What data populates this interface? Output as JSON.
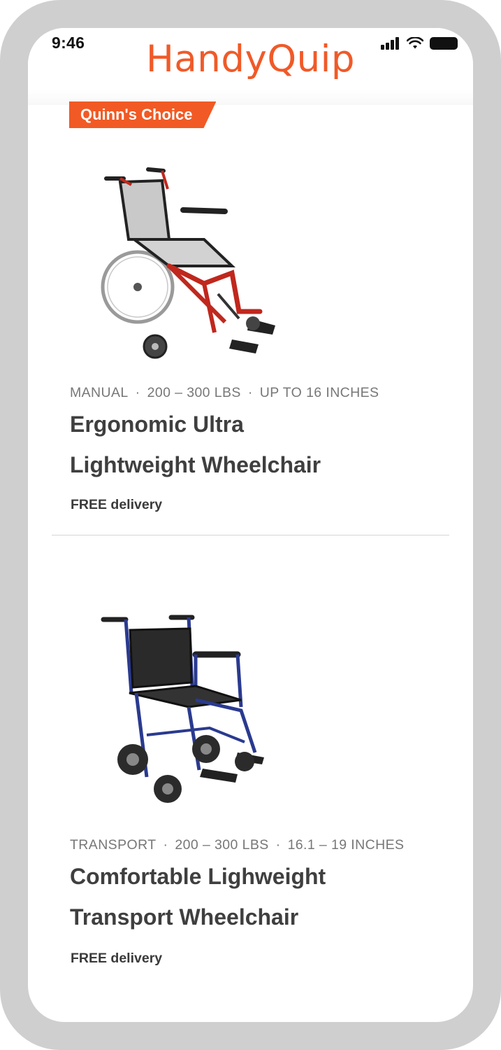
{
  "status_bar": {
    "time": "9:46"
  },
  "brand": {
    "name": "HandyQuip",
    "color": "#f05a28"
  },
  "products": [
    {
      "badge": "Quinn's Choice",
      "meta": [
        "MANUAL",
        "200 – 300 LBS",
        "UP TO 16 INCHES"
      ],
      "title_line1": "Ergonomic Ultra",
      "title_line2": "Lightweight Wheelchair",
      "delivery": "FREE delivery",
      "image_icon": "wheelchair-red-frame"
    },
    {
      "meta": [
        "TRANSPORT",
        "200 – 300 LBS",
        "16.1 – 19 INCHES"
      ],
      "title_line1": "Comfortable Lighweight",
      "title_line2": "Transport Wheelchair",
      "delivery": "FREE delivery",
      "image_icon": "wheelchair-blue-frame"
    }
  ],
  "colors": {
    "badge": "#f15a24",
    "title": "#3f3f3f",
    "meta": "#777777"
  }
}
